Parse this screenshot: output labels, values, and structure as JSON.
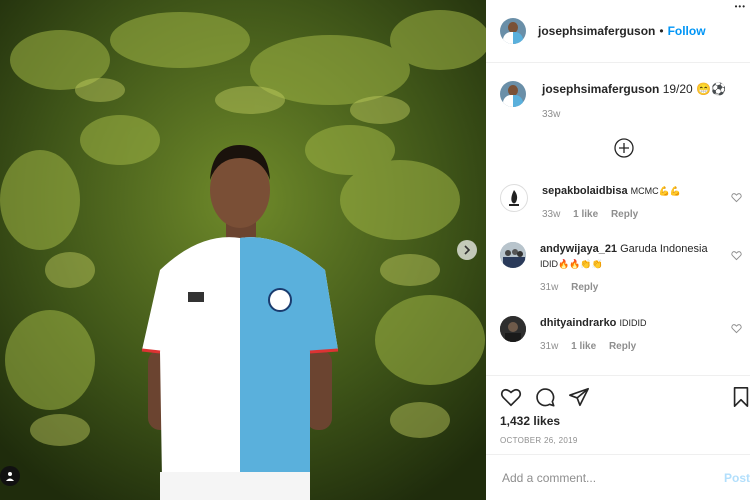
{
  "post": {
    "author": "josephsimaferguson",
    "follow_label": "Follow",
    "dot": "•",
    "more_icon": "more-options-icon",
    "caption_text": "19/20 😁⚽",
    "caption_age": "33w",
    "likes": "1,432 likes",
    "date": "OCTOBER 26, 2019",
    "comment_placeholder": "Add a comment...",
    "post_label": "Post"
  },
  "comments": [
    {
      "user": "sepakbolaidbisa",
      "text": "MCMC💪💪",
      "age": "33w",
      "likes": "1 like",
      "reply": "Reply"
    },
    {
      "user": "andywijaya_21",
      "text": "Garuda Indonesia",
      "text2": "IDID🔥🔥👏👏",
      "age": "31w",
      "reply": "Reply"
    },
    {
      "user": "dhityaindrarko",
      "text": "IDIDID",
      "age": "31w",
      "likes": "1 like",
      "reply": "Reply"
    }
  ],
  "colors": {
    "accent": "#0095f6",
    "muted": "#8e8e8e",
    "jersey_blue": "#5ab0dc"
  }
}
